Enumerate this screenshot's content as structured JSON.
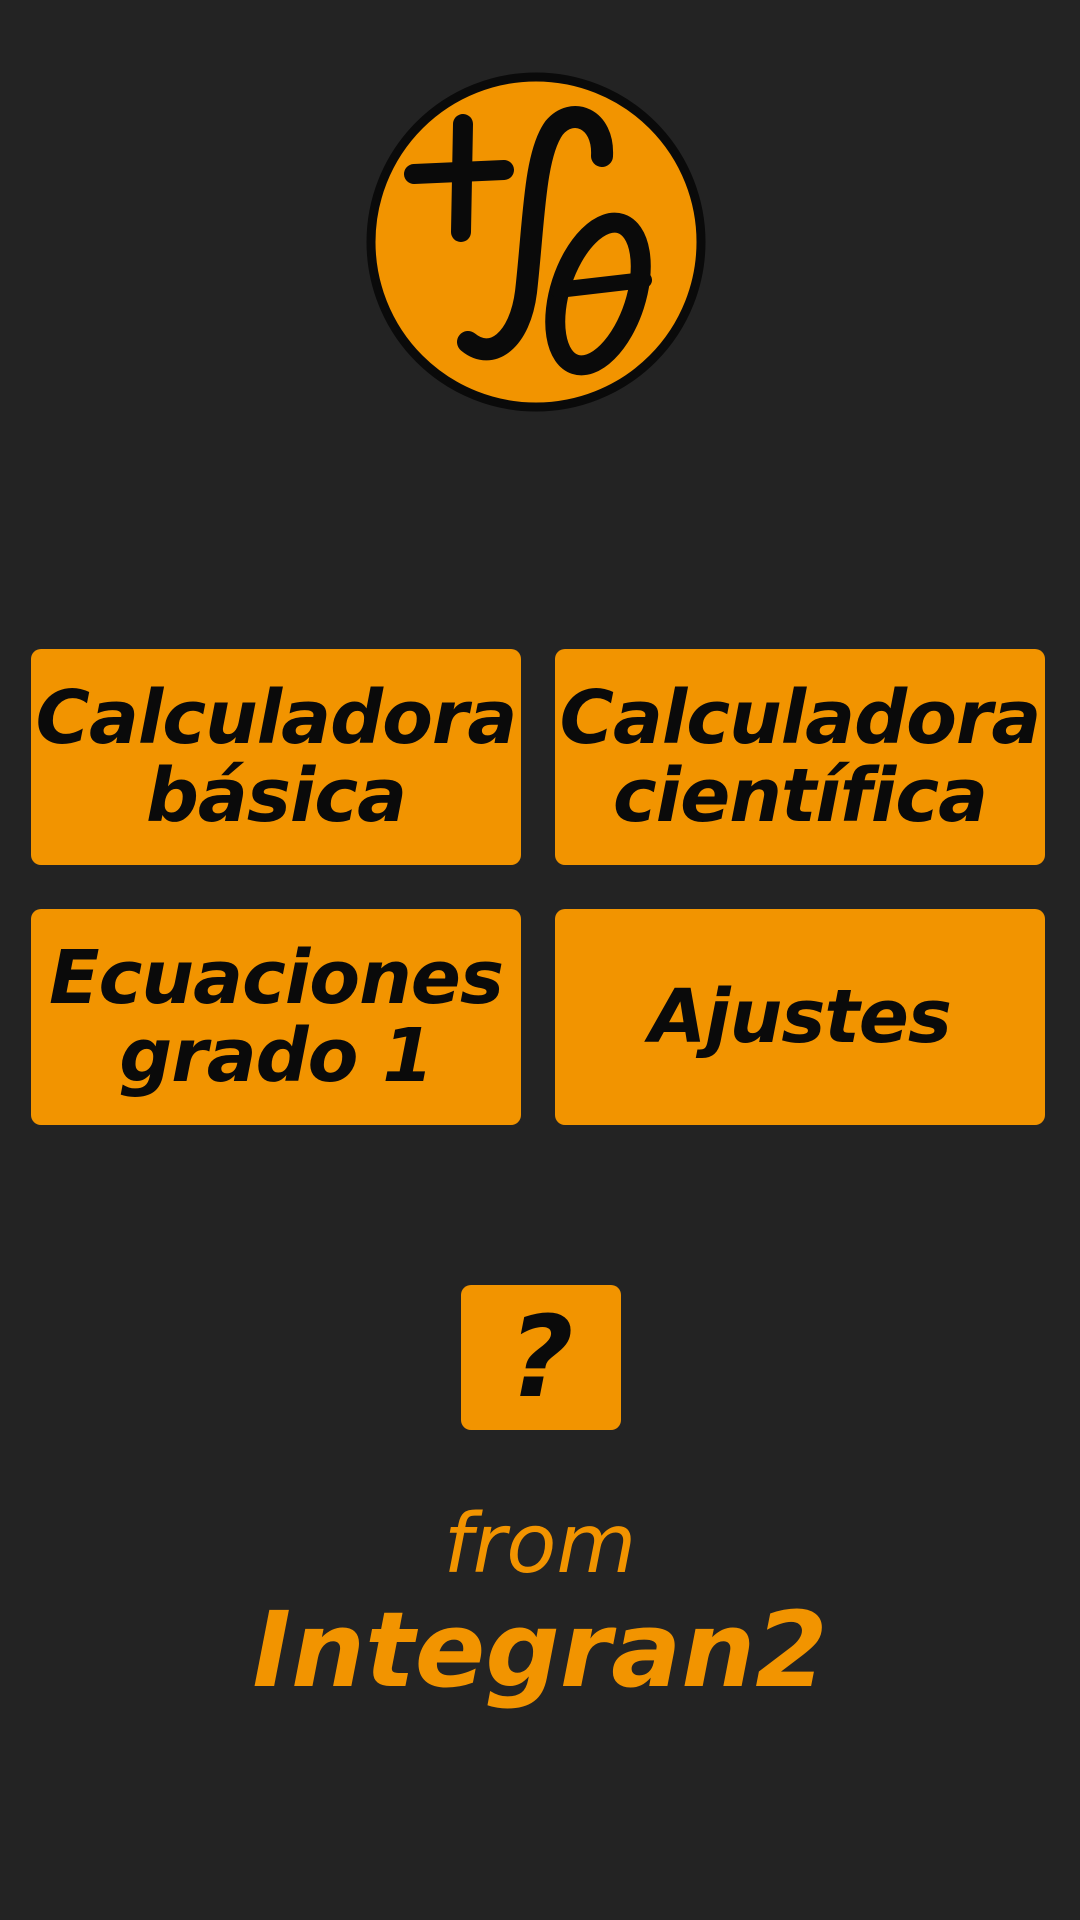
{
  "app": {
    "logo_icon": "integral-theta-logo",
    "accent_color": "#f29400",
    "background_color": "#232323"
  },
  "menu": {
    "basic_calc": {
      "line1": "Calculadora",
      "line2": "básica"
    },
    "scientific_calc": {
      "line1": "Calculadora",
      "line2": "científica"
    },
    "equations": {
      "line1": "Ecuaciones",
      "line2": "grado 1"
    },
    "settings": {
      "label": "Ajustes"
    }
  },
  "help": {
    "label": "?"
  },
  "footer": {
    "from": "from",
    "brand": "Integran2"
  }
}
